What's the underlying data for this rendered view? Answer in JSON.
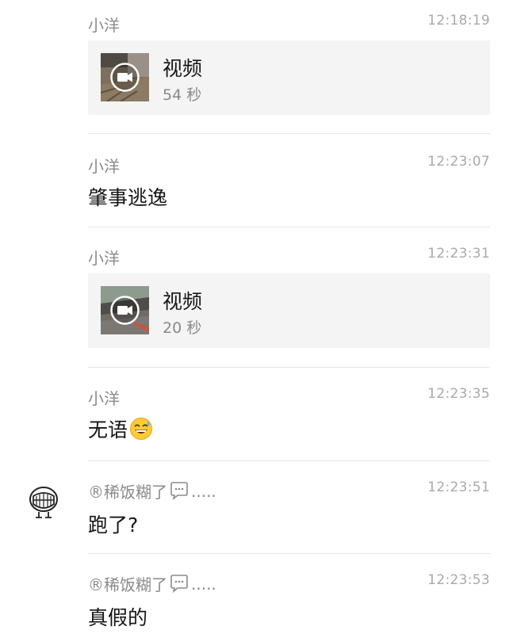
{
  "messages": [
    {
      "sender": "小洋",
      "time": "12:18:19",
      "type": "video",
      "title": "视频",
      "duration": "54 秒"
    },
    {
      "sender": "小洋",
      "time": "12:23:07",
      "type": "text",
      "text": "肇事逃逸"
    },
    {
      "sender": "小洋",
      "time": "12:23:31",
      "type": "video",
      "title": "视频",
      "duration": "20 秒"
    },
    {
      "sender": "小洋",
      "time": "12:23:35",
      "type": "text",
      "text": "无语",
      "emoji": "sweat-smile-emoji"
    },
    {
      "sender_prefix": "®稀饭糊了",
      "sender_suffix": ".....",
      "time": "12:23:51",
      "type": "text",
      "text": "跑了?",
      "avatar": "grinning-face-avatar"
    },
    {
      "sender_prefix": "®稀饭糊了",
      "sender_suffix": ".....",
      "time": "12:23:53",
      "type": "text",
      "text": "真假的"
    }
  ],
  "icons": {
    "video_play": "video-camera-icon",
    "speech_bubble": "speech-bubble-icon"
  },
  "colors": {
    "sender": "#8a8a8a",
    "time": "#a9a9a9",
    "text": "#161616",
    "card_bg": "#f4f4f4",
    "divider": "#e4e4e4"
  }
}
